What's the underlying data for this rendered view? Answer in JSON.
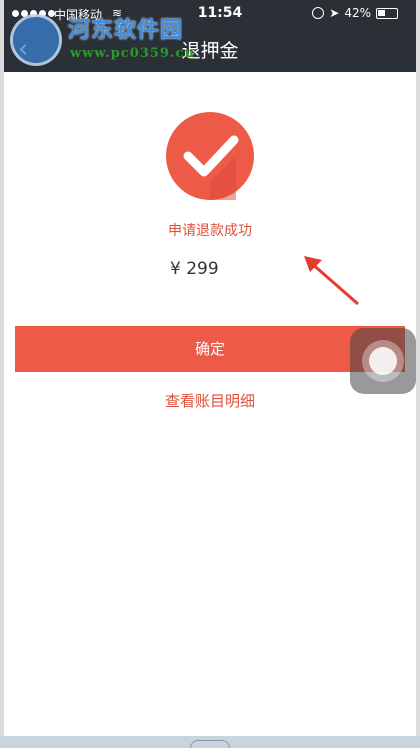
{
  "status_bar": {
    "carrier": "中国移动",
    "time": "11:54",
    "battery": "42%"
  },
  "nav": {
    "title": "退押金"
  },
  "watermark": {
    "name": "河东软件园",
    "url": "www.pc0359.cn"
  },
  "result": {
    "message": "申请退款成功",
    "amount": "¥ 299"
  },
  "actions": {
    "confirm_label": "确定",
    "detail_label": "查看账目明细"
  },
  "colors": {
    "accent": "#ee5a48",
    "header": "#2b2f36",
    "text": "#333333"
  },
  "icons": {
    "success": "checkmark-circle-icon",
    "back": "back-arrow-icon",
    "annotation": "red-arrow-icon",
    "assistive_touch": "assistive-touch-icon"
  }
}
